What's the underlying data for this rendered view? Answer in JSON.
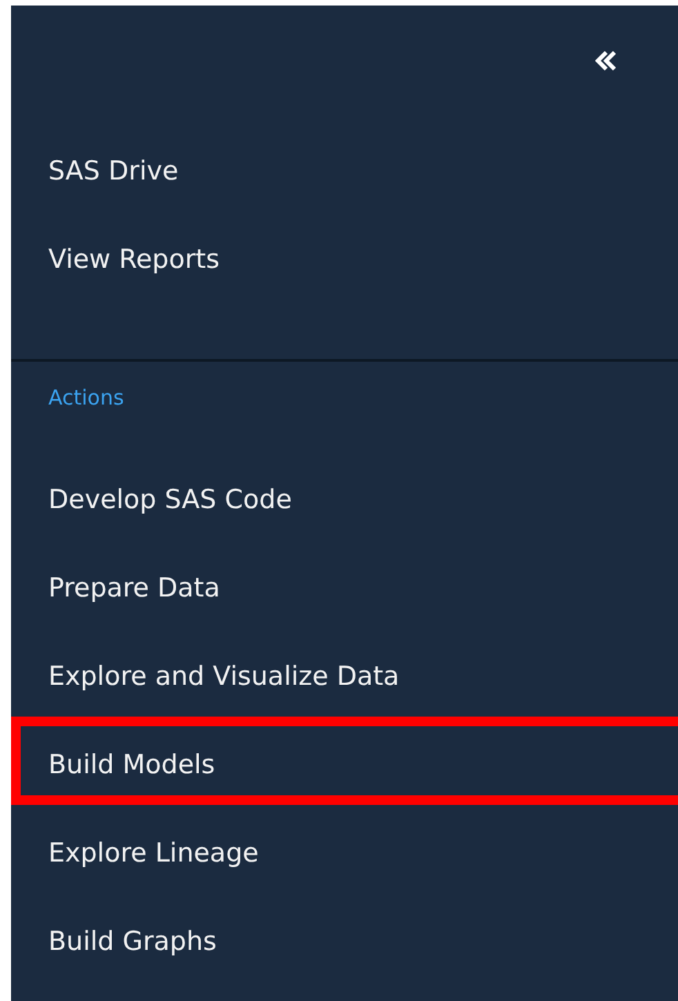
{
  "top_items": [
    {
      "label": "SAS Drive",
      "highlighted": false
    },
    {
      "label": "View Reports",
      "highlighted": false
    }
  ],
  "section": {
    "title": "Actions",
    "items": [
      {
        "label": "Develop SAS Code",
        "highlighted": false
      },
      {
        "label": "Prepare Data",
        "highlighted": false
      },
      {
        "label": "Explore and Visualize Data",
        "highlighted": false
      },
      {
        "label": "Build Models",
        "highlighted": true
      },
      {
        "label": "Explore Lineage",
        "highlighted": false
      },
      {
        "label": "Build Graphs",
        "highlighted": false
      }
    ]
  }
}
